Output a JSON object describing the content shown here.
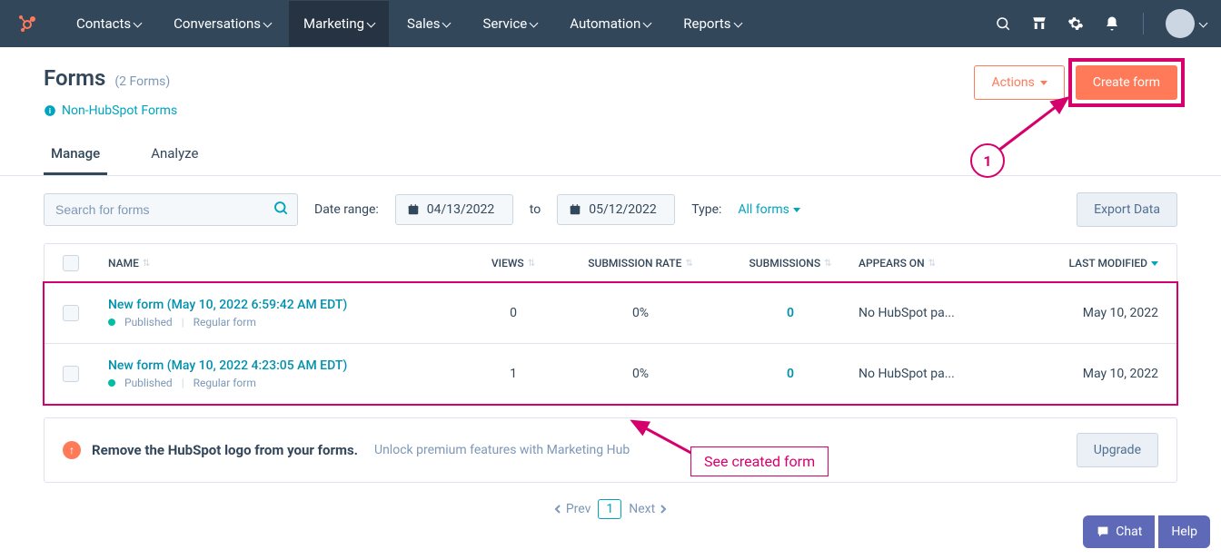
{
  "nav": {
    "items": [
      "Contacts",
      "Conversations",
      "Marketing",
      "Sales",
      "Service",
      "Automation",
      "Reports"
    ],
    "activeIndex": 2
  },
  "header": {
    "title": "Forms",
    "count_label": "(2 Forms)",
    "non_hubspot_label": "Non-HubSpot Forms",
    "actions_label": "Actions",
    "create_label": "Create form"
  },
  "tabs": [
    "Manage",
    "Analyze"
  ],
  "filters": {
    "search_placeholder": "Search for forms",
    "date_range_label": "Date range:",
    "date_from": "04/13/2022",
    "date_to_label": "to",
    "date_to": "05/12/2022",
    "type_label": "Type:",
    "type_value": "All forms",
    "export_label": "Export Data"
  },
  "table": {
    "headers": {
      "name": "NAME",
      "views": "VIEWS",
      "submission_rate": "SUBMISSION RATE",
      "submissions": "SUBMISSIONS",
      "appears_on": "APPEARS ON",
      "last_modified": "LAST MODIFIED"
    },
    "rows": [
      {
        "name": "New form (May 10, 2022 6:59:42 AM EDT)",
        "status": "Published",
        "type": "Regular form",
        "views": "0",
        "submission_rate": "0%",
        "submissions": "0",
        "appears_on": "No HubSpot pa...",
        "last_modified": "May 10, 2022"
      },
      {
        "name": "New form (May 10, 2022 4:23:05 AM EDT)",
        "status": "Published",
        "type": "Regular form",
        "views": "1",
        "submission_rate": "0%",
        "submissions": "0",
        "appears_on": "No HubSpot pa...",
        "last_modified": "May 10, 2022"
      }
    ]
  },
  "banner": {
    "title": "Remove the HubSpot logo from your forms.",
    "text": "Unlock premium features with Marketing Hub",
    "button": "Upgrade"
  },
  "pagination": {
    "prev": "Prev",
    "next": "Next",
    "current": "1"
  },
  "widgets": {
    "chat": "Chat",
    "help": "Help"
  },
  "annotations": {
    "step1": "1",
    "see_created": "See created form"
  }
}
